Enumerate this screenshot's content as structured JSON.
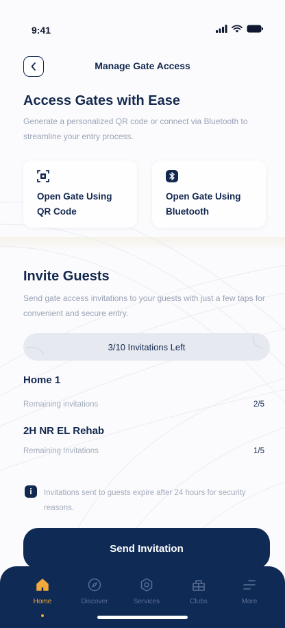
{
  "status_bar": {
    "time": "9:41"
  },
  "header": {
    "title": "Manage Gate Access"
  },
  "access": {
    "title": "Access Gates with Ease",
    "description": "Generate a personalized QR code or connect via Bluetooth to streamline your entry process.",
    "cards": [
      {
        "label": "Open Gate Using QR Code",
        "icon": "qr-code-icon"
      },
      {
        "label": "Open Gate Using Bluetooth",
        "icon": "bluetooth-icon"
      }
    ]
  },
  "invite": {
    "title": "Invite Guests",
    "description": "Send gate access invitations to your guests with just a few taps for convenient and secure entry.",
    "invitations_left": "3/10 Invitations Left",
    "homes": [
      {
        "name": "Home 1",
        "label": "Remaining invitations",
        "value": "2/5"
      },
      {
        "name": "2H NR EL Rehab",
        "label": "Remaining Invitations",
        "value": "1/5"
      }
    ],
    "note": "Invitations sent to guests expire after 24 hours for security reasons.",
    "send_label": "Send Invitation"
  },
  "tabs": [
    {
      "label": "Home",
      "icon": "home-icon",
      "active": true
    },
    {
      "label": "Discover",
      "icon": "compass-icon",
      "active": false
    },
    {
      "label": "Services",
      "icon": "services-icon",
      "active": false
    },
    {
      "label": "Clubs",
      "icon": "clubs-icon",
      "active": false
    },
    {
      "label": "More",
      "icon": "menu-icon",
      "active": false
    }
  ],
  "colors": {
    "primary": "#0f2a55",
    "accent": "#f2a93b",
    "muted": "#9aa3b5"
  }
}
